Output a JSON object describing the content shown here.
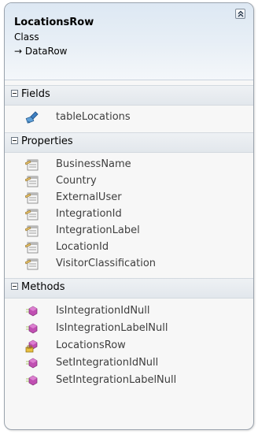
{
  "class": {
    "name": "LocationsRow",
    "kind": "Class",
    "base": "→ DataRow"
  },
  "sections": {
    "fields": {
      "label": "Fields",
      "items": [
        {
          "label": "tableLocations",
          "icon": "field-icon"
        }
      ]
    },
    "properties": {
      "label": "Properties",
      "items": [
        {
          "label": "BusinessName",
          "icon": "property-icon"
        },
        {
          "label": "Country",
          "icon": "property-icon"
        },
        {
          "label": "ExternalUser",
          "icon": "property-icon"
        },
        {
          "label": "IntegrationId",
          "icon": "property-icon"
        },
        {
          "label": "IntegrationLabel",
          "icon": "property-icon"
        },
        {
          "label": "LocationId",
          "icon": "property-icon"
        },
        {
          "label": "VisitorClassification",
          "icon": "property-icon"
        }
      ]
    },
    "methods": {
      "label": "Methods",
      "items": [
        {
          "label": "IsIntegrationIdNull",
          "icon": "method-icon"
        },
        {
          "label": "IsIntegrationLabelNull",
          "icon": "method-icon"
        },
        {
          "label": "LocationsRow",
          "icon": "constructor-icon"
        },
        {
          "label": "SetIntegrationIdNull",
          "icon": "method-icon"
        },
        {
          "label": "SetIntegrationLabelNull",
          "icon": "method-icon"
        }
      ]
    }
  },
  "colors": {
    "header_gradient_top": "#dde8f3",
    "method_icon": "#b43fa5",
    "property_icon": "#e8c26a"
  }
}
